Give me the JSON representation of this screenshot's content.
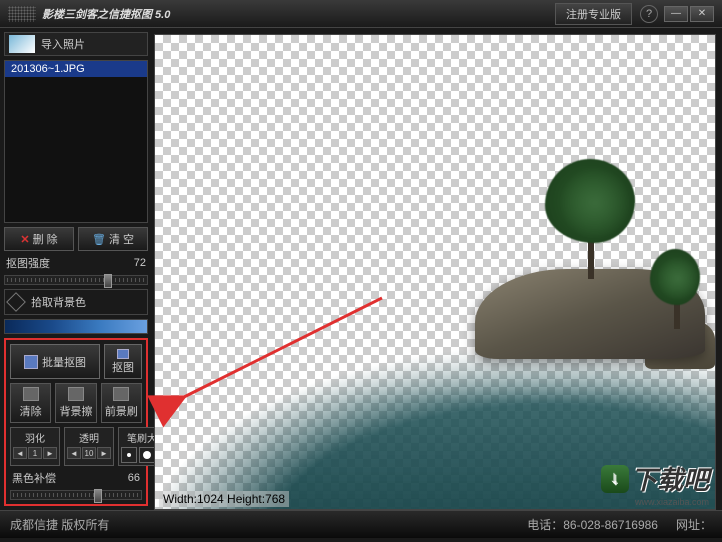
{
  "title": "影楼三剑客之信捷抠图 5.0",
  "register": "注册专业版",
  "import": "导入照片",
  "files": [
    "201306~1.JPG"
  ],
  "delete_btn": "删 除",
  "clear_btn": "清 空",
  "intensity_label": "抠图强度",
  "intensity_value": "72",
  "pick_bg": "拾取背景色",
  "batch": "批量抠图",
  "single": "抠图",
  "clear2": "清除",
  "bg_eraser": "背景擦",
  "fg_brush": "前景刷",
  "feather": "羽化",
  "opacity": "透明",
  "brush_size": "笔刷大小",
  "feather_val": "1",
  "opacity_val": "10",
  "black_comp": "黑色补偿",
  "black_comp_val": "66",
  "dim_label": "Width:1024  Height:768",
  "footer_left": "成都信捷 版权所有",
  "footer_phone": "电话：86-028-86716986",
  "footer_web": "网址：",
  "watermark": "下载吧",
  "watermark_sub": "www.xiazaiba.com"
}
